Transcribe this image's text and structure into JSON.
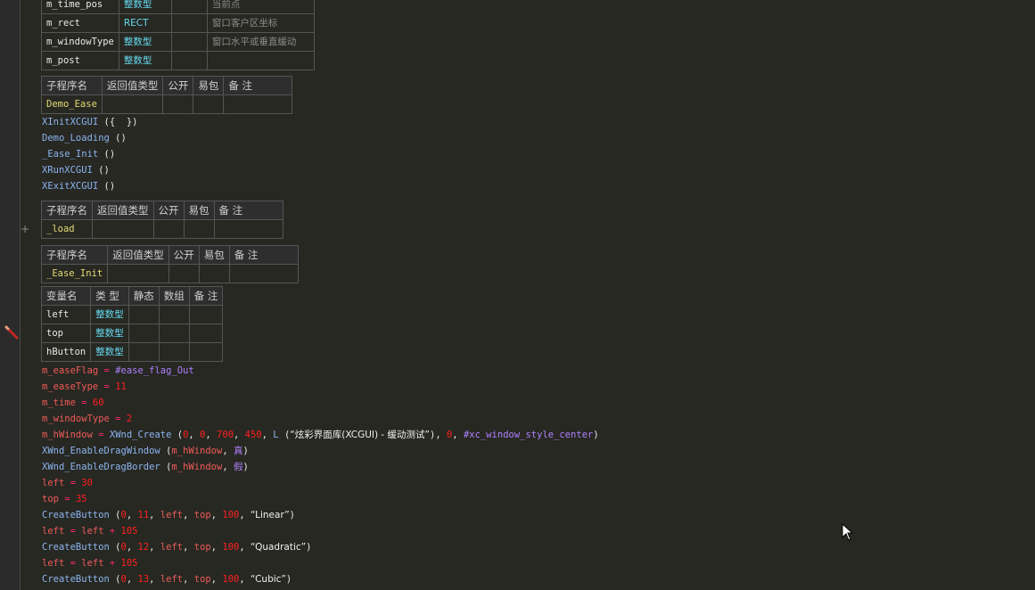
{
  "vars_table": {
    "rows": [
      {
        "name": "m_time_pos",
        "type": "整数型",
        "note": "当前点"
      },
      {
        "name": "m_rect",
        "type": "RECT",
        "note": "窗口客户区坐标"
      },
      {
        "name": "m_windowType",
        "type": "整数型",
        "note": "窗口水平或垂直缓动"
      },
      {
        "name": "m_post",
        "type": "整数型",
        "note": ""
      }
    ]
  },
  "sub_header": {
    "name": "子程序名",
    "ret": "返回值类型",
    "public": "公开",
    "easy": "易包",
    "note": "备 注"
  },
  "sub1": {
    "name": "Demo_Ease"
  },
  "calls": [
    {
      "fn": "XInitXCGUI",
      "args": " ({  })"
    },
    {
      "fn": "Demo_Loading",
      "args": " ()"
    },
    {
      "fn": "_Ease_Init",
      "args": " ()"
    },
    {
      "fn": "XRunXCGUI",
      "args": " ()"
    },
    {
      "fn": "XExitXCGUI",
      "args": " ()"
    }
  ],
  "sub2": {
    "name": "_load"
  },
  "sub3": {
    "name": "_Ease_Init"
  },
  "local_header": {
    "name": "变量名",
    "type": "类 型",
    "static": "静态",
    "array": "数组",
    "note": "备 注"
  },
  "locals": [
    {
      "name": "left",
      "type": "整数型"
    },
    {
      "name": "top",
      "type": "整数型"
    },
    {
      "name": "hButton",
      "type": "整数型"
    }
  ],
  "code": {
    "l1": {
      "var": "m_easeFlag",
      "eq": " = ",
      "val": "#ease_flag_Out"
    },
    "l2": {
      "var": "m_easeType",
      "eq": " = ",
      "val": "11"
    },
    "l3": {
      "var": "m_time",
      "eq": " = ",
      "val": "60"
    },
    "l4": {
      "var": "m_windowType",
      "eq": " = ",
      "val": "2"
    },
    "l5": {
      "var": "m_hWindow",
      "eq": " = ",
      "fn": "XWnd_Create",
      "open": " (",
      "a1": "0",
      "a2": "0",
      "a3": "700",
      "a4": "450",
      "lfn": "L",
      "str": "“炫彩界面库(XCGUI) - 缓动测试”",
      "a5": "0",
      "const": "#xc_window_style_center",
      "close": ")"
    },
    "l6": {
      "fn": "XWnd_EnableDragWindow",
      "var": "m_hWindow",
      "kw": "真"
    },
    "l7": {
      "fn": "XWnd_EnableDragBorder",
      "var": "m_hWindow",
      "kw": "假"
    },
    "l8": {
      "var": "left",
      "eq": " = ",
      "val": "30"
    },
    "l9": {
      "var": "top",
      "eq": " = ",
      "val": "35"
    },
    "l10": {
      "fn": "CreateButton",
      "n1": "0",
      "n2": "11",
      "v1": "left",
      "v2": "top",
      "n3": "100",
      "str": "“Linear”"
    },
    "l11": {
      "var": "left",
      "eq": " = ",
      "v2": "left",
      "plus": " + ",
      "val": "105"
    },
    "l12": {
      "fn": "CreateButton",
      "n1": "0",
      "n2": "12",
      "v1": "left",
      "v2": "top",
      "n3": "100",
      "str": "“Quadratic”"
    },
    "l13": {
      "var": "left",
      "eq": " = ",
      "v2": "left",
      "plus": " + ",
      "val": "105"
    },
    "l14": {
      "fn": "CreateButton",
      "n1": "0",
      "n2": "13",
      "v1": "left",
      "v2": "top",
      "n3": "100",
      "str": "“Cubic”"
    }
  },
  "gutter": {
    "fold_symbol": "+",
    "marker_icon": "pencil-icon"
  },
  "colors": {
    "background": "#272822",
    "function": "#8cb4f0",
    "variable": "#f05a5a",
    "number": "#ff2020",
    "type": "#66d9ef",
    "constant": "#ae81ff"
  }
}
